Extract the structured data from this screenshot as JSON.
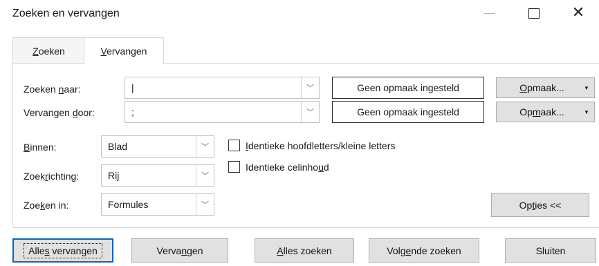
{
  "window": {
    "title": "Zoeken en vervangen",
    "minimize_icon": "minimize-icon",
    "maximize_icon": "maximize-icon",
    "close_icon": "close-icon",
    "close_glyph": "✕"
  },
  "tabs": {
    "find": {
      "pre": "",
      "key": "Z",
      "post": "oeken"
    },
    "replace": {
      "pre": "",
      "key": "V",
      "post": "ervangen"
    }
  },
  "find_what": {
    "label": {
      "pre": "Zoeken ",
      "key": "n",
      "post": "aar:"
    },
    "value": "|",
    "format_status": "Geen opmaak ingesteld",
    "format_button": {
      "pre": "",
      "key": "O",
      "post": "pmaak..."
    }
  },
  "replace_with": {
    "label": {
      "pre": "Vervangen ",
      "key": "d",
      "post": "oor:"
    },
    "value": ";",
    "format_status": "Geen opmaak ingesteld",
    "format_button": {
      "pre": "Op",
      "key": "m",
      "post": "aak..."
    }
  },
  "within": {
    "label": {
      "pre": "",
      "key": "B",
      "post": "innen:"
    },
    "value": "Blad"
  },
  "search_direction": {
    "label": {
      "pre": "Zoek",
      "key": "r",
      "post": "ichting:"
    },
    "value": "Rij"
  },
  "look_in": {
    "label": {
      "pre": "Zoe",
      "key": "k",
      "post": "en in:"
    },
    "value": "Formules"
  },
  "options": {
    "match_case": {
      "pre": "",
      "key": "I",
      "post": "dentieke hoofdletters/kleine letters",
      "checked": false
    },
    "match_entire_cell": {
      "pre": "Identieke celinho",
      "key": "u",
      "post": "d",
      "checked": false
    }
  },
  "options_button": {
    "pre": "Op",
    "key": "t",
    "post": "ies <<"
  },
  "bottom_buttons": {
    "replace_all": {
      "pre": "Alle",
      "key": "s",
      "post": " vervangen"
    },
    "replace": {
      "pre": "Verva",
      "key": "n",
      "post": "gen"
    },
    "find_all": {
      "pre": "",
      "key": "A",
      "post": "lles zoeken"
    },
    "find_next": {
      "pre": "Volg",
      "key": "e",
      "post": "nde zoeken"
    },
    "close": {
      "pre": "Sluiten",
      "key": "",
      "post": ""
    }
  },
  "dropdown_arrow_glyph": "﹀",
  "split_caret_glyph": "▼",
  "colors": {
    "default_button_border": "#0067c0",
    "button_bg": "#e1e1e1",
    "tab_inactive_bg": "#f5f5f5"
  }
}
